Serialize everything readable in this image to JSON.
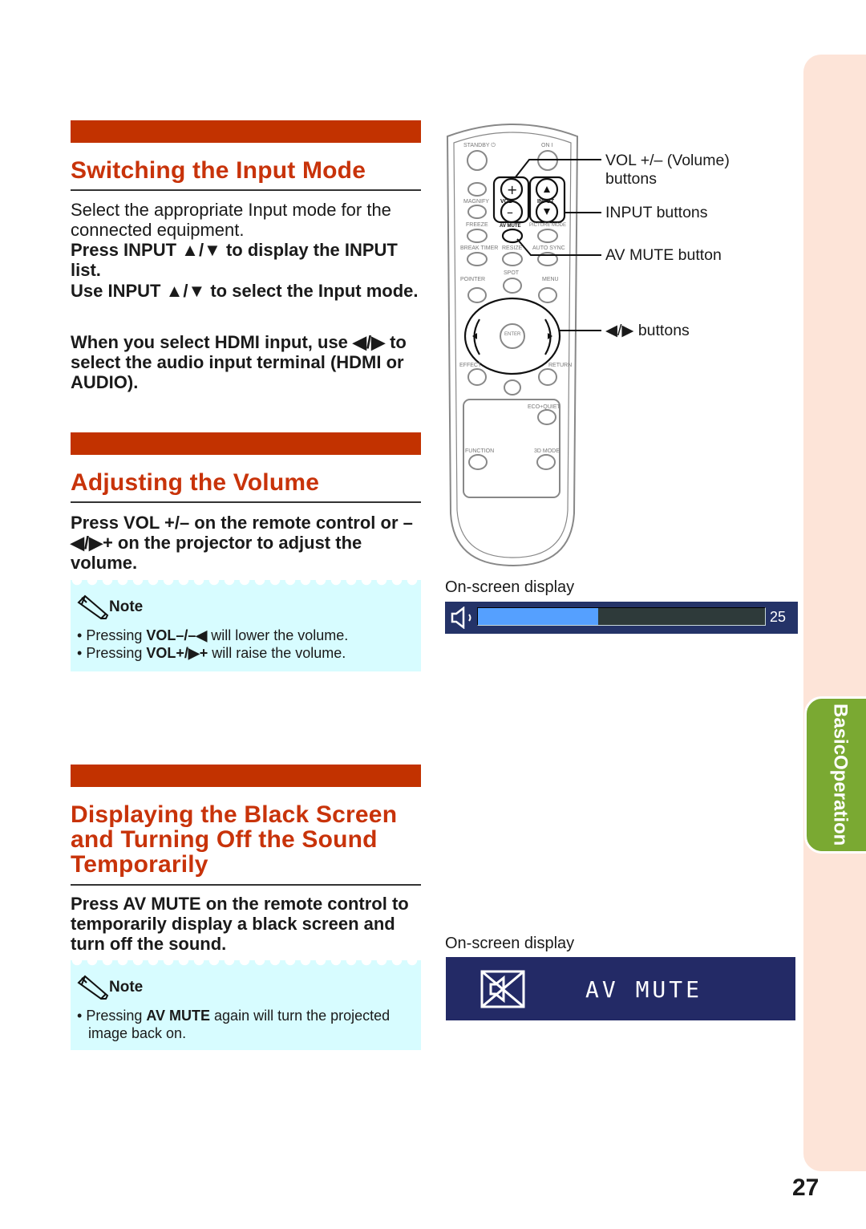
{
  "sections": [
    {
      "title": "Switching the Input Mode",
      "paragraphs": [
        [
          {
            "t": "Select the appropriate Input mode for the connected equipment.",
            "b": false
          }
        ],
        [
          {
            "t": "Press INPUT ▲/▼ to display the INPUT list.",
            "b": true
          }
        ],
        [
          {
            "t": "Use INPUT ▲/▼ to select the Input mode.",
            "b": true
          }
        ],
        [
          {
            "t": "When you select HDMI input, use ◀/▶ to select the audio input terminal (HDMI or AUDIO).",
            "b": true
          }
        ]
      ]
    },
    {
      "title": "Adjusting the Volume",
      "paragraphs": [
        [
          {
            "t": "Press VOL +/– on the remote control or –◀/▶+ on the projector to adjust the volume.",
            "b": true
          }
        ]
      ],
      "note": {
        "heading": "Note",
        "items": [
          [
            {
              "t": "Pressing ",
              "b": false
            },
            {
              "t": "VOL–/–◀",
              "b": true
            },
            {
              "t": " will lower the volume.",
              "b": false
            }
          ],
          [
            {
              "t": "Pressing ",
              "b": false
            },
            {
              "t": "VOL+/▶+",
              "b": true
            },
            {
              "t": " will raise the volume.",
              "b": false
            }
          ]
        ]
      }
    },
    {
      "title": "Displaying the Black Screen and Turning Off the Sound Temporarily",
      "paragraphs": [
        [
          {
            "t": "Press AV MUTE on the remote control to temporarily display a black screen and turn off the sound.",
            "b": true
          }
        ]
      ],
      "note": {
        "heading": "Note",
        "items": [
          [
            {
              "t": "Pressing ",
              "b": false
            },
            {
              "t": "AV MUTE",
              "b": true
            },
            {
              "t": " again will turn the projected image back on.",
              "b": false
            }
          ]
        ]
      }
    }
  ],
  "remote": {
    "labels": {
      "standby": "STANDBY ⏻",
      "on": "ON I",
      "magnify": "MAGNIFY",
      "vol": "VOL",
      "input": "INPUT",
      "freeze": "FREEZE",
      "av_mute": "AV MUTE",
      "picture_mode": "PICTURE MODE",
      "break_timer": "BREAK TIMER",
      "resize": "RESIZE",
      "auto_sync": "AUTO SYNC",
      "pointer": "POINTER",
      "spot": "SPOT",
      "menu": "MENU",
      "enter": "ENTER",
      "effect": "EFFECT",
      "return": "RETURN",
      "eco_quiet": "ECO+QUIET",
      "function": "FUNCTION",
      "mode_3d": "3D MODE"
    },
    "callouts": {
      "vol": "VOL +/– (Volume) buttons",
      "input": "INPUT buttons",
      "av_mute": "AV MUTE button",
      "arrows": "◀/▶ buttons"
    }
  },
  "volume_osd": {
    "label": "On-screen display",
    "value": "25",
    "fill_fraction": 0.42,
    "icon": "speaker-icon",
    "colors": {
      "background": "#243368",
      "fill": "#55a0ff",
      "track": "#2e3a3a"
    }
  },
  "avmute_osd": {
    "label": "On-screen display",
    "text": "AV MUTE",
    "icon": "av-mute-icon",
    "colors": {
      "background": "#232a66"
    }
  },
  "side_tab": {
    "line1": "Basic",
    "line2": "Operation",
    "color": "#7aa932"
  },
  "page_number": "27"
}
